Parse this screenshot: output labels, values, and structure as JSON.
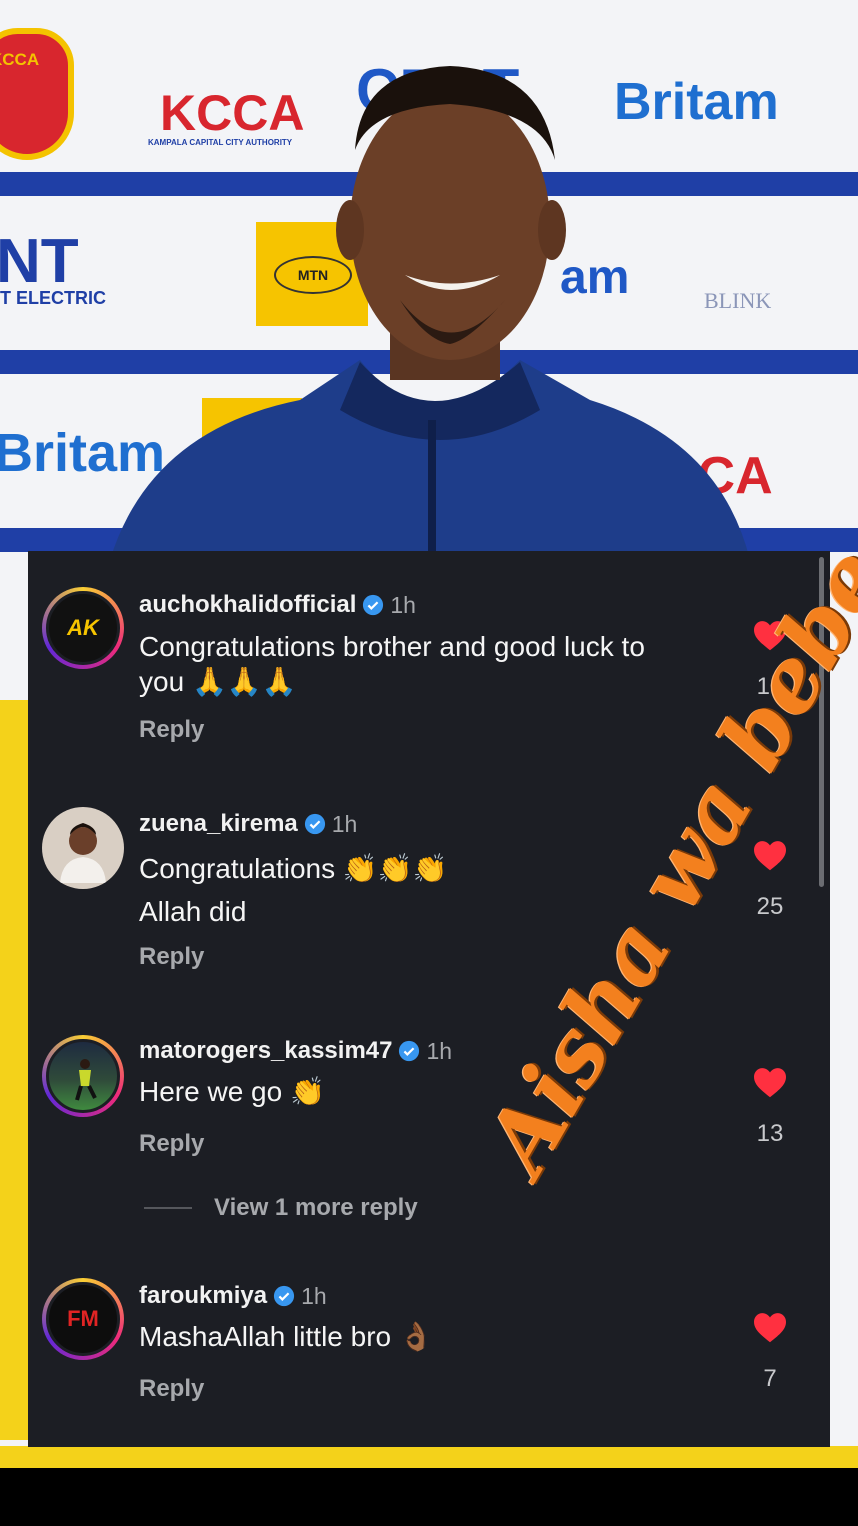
{
  "backdrop": {
    "sponsors": {
      "kcca_badge": "KCCA",
      "kcca": "KCCA",
      "kcca_sub": "KAMPALA CAPITAL CITY AUTHORITY",
      "britam_top": "Britam",
      "britam_left": "Britam",
      "cent": "CENT",
      "nt": "NT",
      "electric": "T ELECTRIC",
      "mtn": "MTN",
      "am": "am",
      "blink": "BLINK",
      "cca": "CCA"
    }
  },
  "comments": [
    {
      "username": "auchokhalidofficial",
      "time": "1h",
      "text_line1": "Congratulations brother and good luck to",
      "text_line2": "you",
      "emojis": "🙏🙏🙏",
      "reply": "Reply",
      "likes": "16",
      "avatar_label": "AK"
    },
    {
      "username": "zuena_kirema",
      "time": "1h",
      "text_line1": "Congratulations",
      "emojis": "👏👏👏",
      "text_line2": "Allah did",
      "reply": "Reply",
      "likes": "25"
    },
    {
      "username": "matorogers_kassim47",
      "time": "1h",
      "text_line1": "Here we go",
      "emojis": "👏",
      "reply": "Reply",
      "likes": "13"
    },
    {
      "username": "faroukmiya",
      "time": "1h",
      "text_line1": "MashaAllah little bro",
      "emojis": "👌🏾",
      "reply": "Reply",
      "likes": "7",
      "avatar_label": "FM"
    }
  ],
  "view_more": "View 1 more reply",
  "overlay_signature": "Aisha wa bebe",
  "colors": {
    "panel_bg": "#1c1e24",
    "heart": "#ff3040",
    "verified": "#3897f0",
    "band_blue": "#1f3fa6",
    "overlay_orange": "#f3801e"
  }
}
